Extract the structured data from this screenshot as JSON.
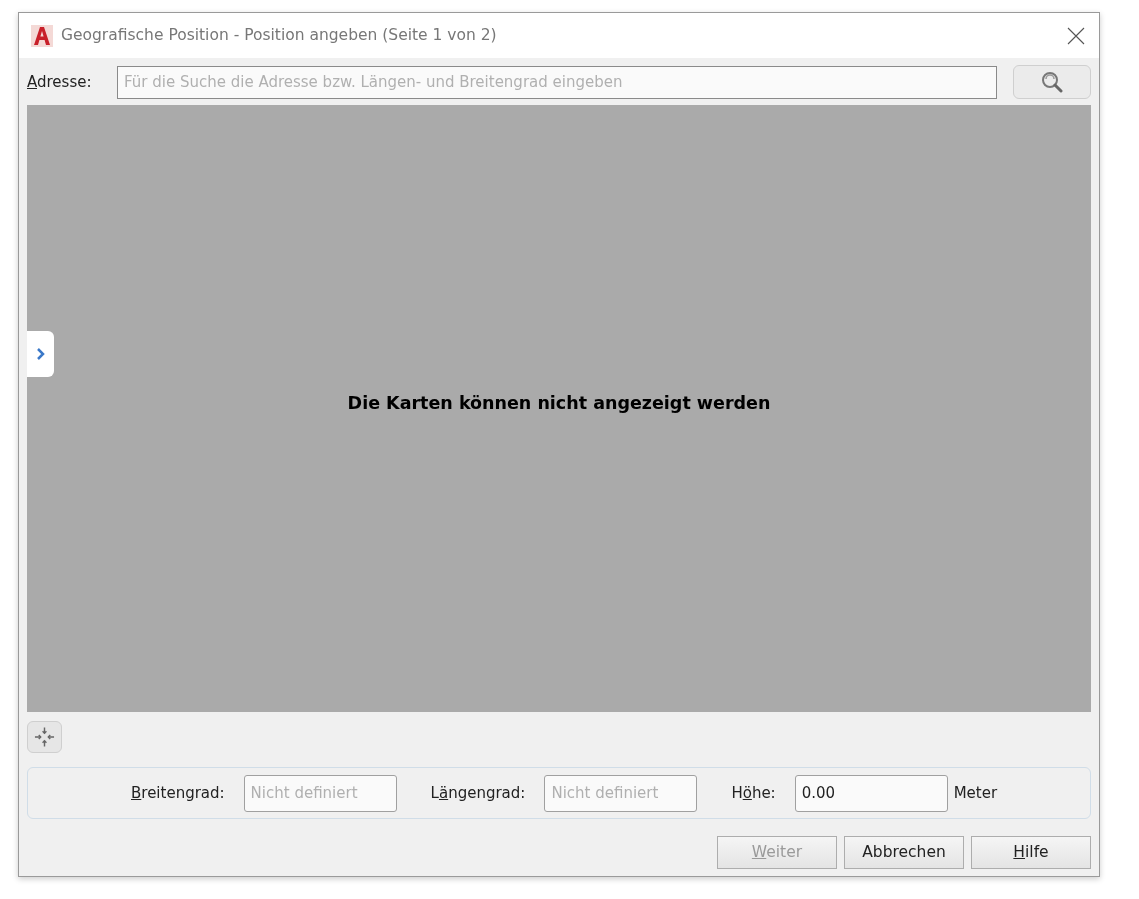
{
  "window": {
    "title": "Geografische Position - Position angeben (Seite 1 von 2)"
  },
  "address": {
    "label": {
      "key": "A",
      "post": "dresse:"
    },
    "placeholder": "Für die Suche die Adresse bzw. Längen- und Breitengrad eingeben"
  },
  "map": {
    "message": "Die Karten können nicht angezeigt werden",
    "panel_expanded": false
  },
  "coordinates": [
    {
      "kind": "text",
      "label": {
        "key": "B",
        "post": "reitengrad:"
      },
      "placeholder": "Nicht definiert"
    },
    {
      "kind": "text",
      "label": {
        "pre": "L",
        "key": "ä",
        "post": "ngengrad:"
      },
      "placeholder": "Nicht definiert"
    },
    {
      "kind": "text",
      "label": {
        "pre": "H",
        "key": "ö",
        "post": "he:"
      },
      "value": "0.00",
      "unit": "Meter"
    }
  ],
  "buttons": [
    {
      "label": {
        "key": "W",
        "post": "eiter"
      },
      "disabled": true
    },
    {
      "label": {
        "post": "Abbrechen"
      },
      "disabled": false
    },
    {
      "label": {
        "key": "H",
        "post": "ilfe"
      },
      "disabled": false
    }
  ]
}
